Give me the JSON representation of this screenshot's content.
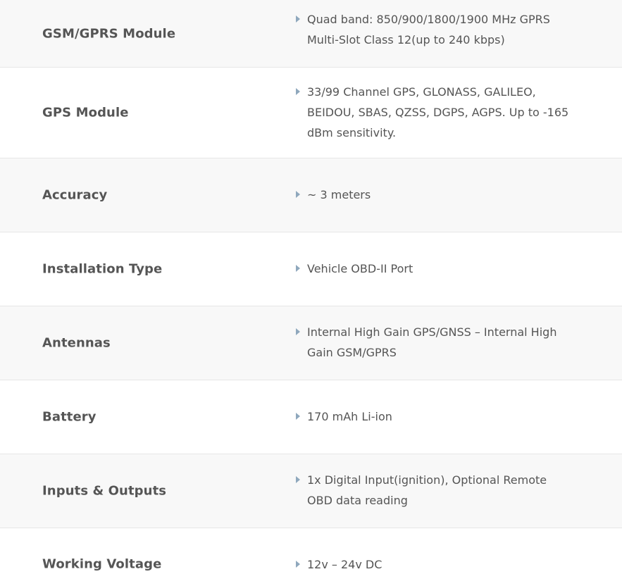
{
  "specs": [
    {
      "label": "GSM/GPRS Module",
      "value": "Quad band: 850/900/1800/1900 MHz GPRS Multi-Slot Class 12(up to 240 kbps)"
    },
    {
      "label": "GPS Module",
      "value": "33/99 Channel GPS, GLONASS, GALILEO, BEIDOU, SBAS, QZSS, DGPS, AGPS. Up to -165 dBm sensitivity."
    },
    {
      "label": "Accuracy",
      "value": "~ 3 meters"
    },
    {
      "label": "Installation Type",
      "value": "Vehicle OBD-II Port"
    },
    {
      "label": "Antennas",
      "value": "Internal High Gain GPS/GNSS – Internal High Gain GSM/GPRS"
    },
    {
      "label": "Battery",
      "value": "170 mAh Li-ion"
    },
    {
      "label": "Inputs & Outputs",
      "value": "1x Digital Input(ignition), Optional Remote OBD data reading"
    },
    {
      "label": "Working Voltage",
      "value": "12v – 24v DC"
    }
  ],
  "icons": {
    "bullet": "caret-right-icon"
  },
  "colors": {
    "bullet": "#8fa8bd",
    "row_shaded": "#f8f8f8",
    "text": "#555555",
    "divider": "#e6e6e6"
  }
}
